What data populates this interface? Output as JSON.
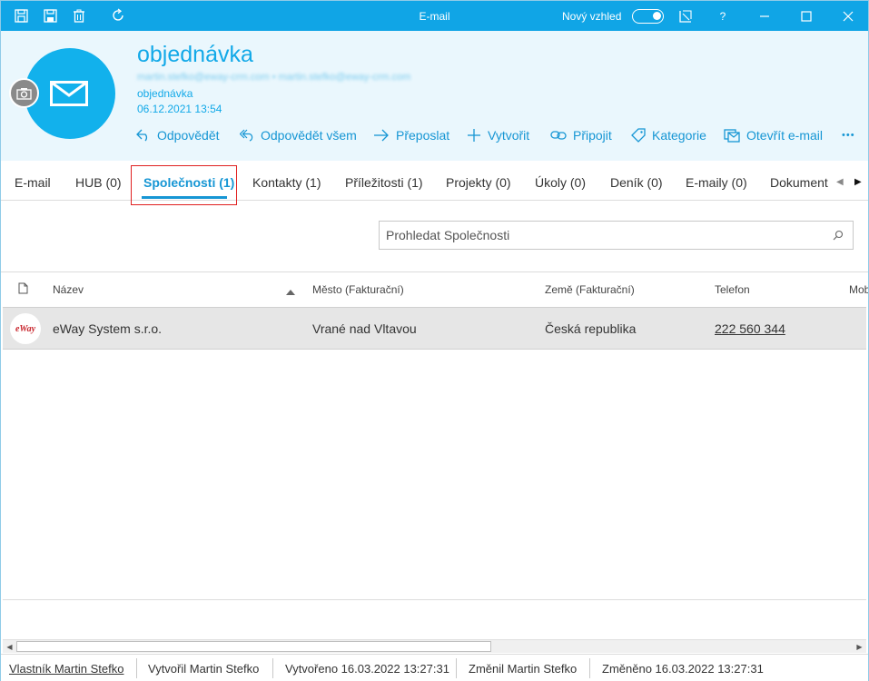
{
  "window": {
    "title": "E-mail",
    "new_look_label": "Nový vzhled",
    "help_label": "?"
  },
  "header": {
    "subject": "objednávka",
    "addresses": "martin.stefko@eway-crm.com • martin.stefko@eway-crm.com",
    "subject_small": "objednávka",
    "date": "06.12.2021 13:54",
    "actions": [
      {
        "label": "Odpovědět"
      },
      {
        "label": "Odpovědět všem"
      },
      {
        "label": "Přeposlat"
      },
      {
        "label": "Vytvořit"
      },
      {
        "label": "Připojit"
      },
      {
        "label": "Kategorie"
      },
      {
        "label": "Otevřít e-mail"
      }
    ],
    "more_label": "•••"
  },
  "tabs": [
    {
      "label": "E-mail"
    },
    {
      "label": "HUB (0)"
    },
    {
      "label": "Společnosti (1)"
    },
    {
      "label": "Kontakty (1)"
    },
    {
      "label": "Příležitosti (1)"
    },
    {
      "label": "Projekty (0)"
    },
    {
      "label": "Úkoly (0)"
    },
    {
      "label": "Deník (0)"
    },
    {
      "label": "E-maily (0)"
    },
    {
      "label": "Dokument"
    }
  ],
  "active_tab": "Společnosti (1)",
  "search": {
    "placeholder": "Prohledat Společnosti",
    "value": ""
  },
  "grid": {
    "columns": [
      {
        "label": "Název",
        "sorted": "ascending"
      },
      {
        "label": "Město (Fakturační)"
      },
      {
        "label": "Země (Fakturační)"
      },
      {
        "label": "Telefon"
      },
      {
        "label": "Mob"
      }
    ],
    "rows": [
      {
        "logo_text": "eWay",
        "name": "eWay System s.r.o.",
        "city": "Vrané nad Vltavou",
        "country": "Česká republika",
        "phone": "222 560 344"
      }
    ]
  },
  "statusbar": {
    "owner": "Vlastník Martin Stefko",
    "created_by": "Vytvořil Martin Stefko",
    "created_at": "Vytvořeno 16.03.2022 13:27:31",
    "changed_by": "Změnil Martin Stefko",
    "changed_at": "Změněno 16.03.2022 13:27:31"
  },
  "colors": {
    "accent": "#10a5e6",
    "link": "#1696d4",
    "highlight": "#e02020",
    "row_selected": "#e6e6e6"
  }
}
